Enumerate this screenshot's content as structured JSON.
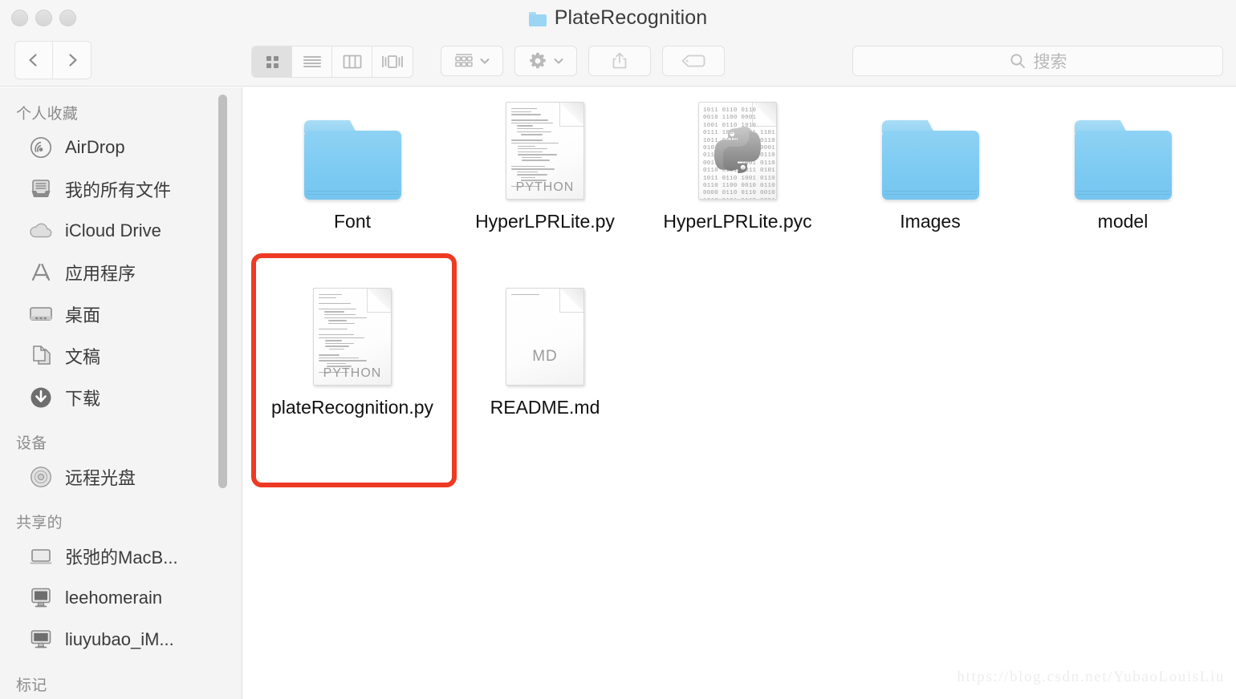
{
  "window": {
    "title": "PlateRecognition",
    "traffic_lights": [
      "close",
      "minimize",
      "zoom"
    ]
  },
  "toolbar": {
    "back_label": "Back",
    "forward_label": "Forward",
    "view_modes": [
      {
        "name": "icon-view",
        "label": "Icon View",
        "active": true
      },
      {
        "name": "list-view",
        "label": "List View",
        "active": false
      },
      {
        "name": "column-view",
        "label": "Column View",
        "active": false
      },
      {
        "name": "gallery-view",
        "label": "Gallery View",
        "active": false
      }
    ],
    "arrange_label": "Arrange",
    "action_label": "Action",
    "share_label": "Share",
    "tag_label": "Edit Tags"
  },
  "search": {
    "placeholder": "搜索",
    "value": ""
  },
  "sidebar": {
    "sections": [
      {
        "title": "个人收藏",
        "items": [
          {
            "label": "AirDrop",
            "icon": "airdrop-icon"
          },
          {
            "label": "我的所有文件",
            "icon": "all-files-icon"
          },
          {
            "label": "iCloud Drive",
            "icon": "icloud-icon"
          },
          {
            "label": "应用程序",
            "icon": "applications-icon"
          },
          {
            "label": "桌面",
            "icon": "desktop-icon"
          },
          {
            "label": "文稿",
            "icon": "documents-icon"
          },
          {
            "label": "下载",
            "icon": "downloads-icon"
          }
        ]
      },
      {
        "title": "设备",
        "items": [
          {
            "label": "远程光盘",
            "icon": "remote-disc-icon"
          }
        ]
      },
      {
        "title": "共享的",
        "items": [
          {
            "label": "张弛的MacB...",
            "icon": "macbook-icon"
          },
          {
            "label": "leehomerain",
            "icon": "imac-icon"
          },
          {
            "label": "liuyubao_iM...",
            "icon": "imac-icon"
          }
        ]
      },
      {
        "title": "标记",
        "items": []
      }
    ]
  },
  "files": [
    {
      "name": "Font",
      "kind": "folder",
      "badge": "",
      "selected": false
    },
    {
      "name": "HyperLPRLite.py",
      "kind": "python-source",
      "badge": "PYTHON",
      "selected": false
    },
    {
      "name": "HyperLPRLite.pyc",
      "kind": "python-compiled",
      "badge": "",
      "selected": false
    },
    {
      "name": "Images",
      "kind": "folder",
      "badge": "",
      "selected": false
    },
    {
      "name": "model",
      "kind": "folder",
      "badge": "",
      "selected": false
    },
    {
      "name": "plateRecognition.py",
      "kind": "python-source",
      "badge": "PYTHON",
      "selected": true
    },
    {
      "name": "README.md",
      "kind": "markdown",
      "badge": "MD",
      "selected": false
    }
  ],
  "annotation": {
    "highlight_color": "#ee3a23",
    "highlight_target": "plateRecognition.py"
  },
  "watermark": "https://blog.csdn.net/YubaoLouisLiu",
  "colors": {
    "folder_blue": "#7dcbf2",
    "chrome_gray": "#f6f6f6",
    "sidebar_gray": "#f4f4f4",
    "accent_red": "#ee3a23"
  }
}
